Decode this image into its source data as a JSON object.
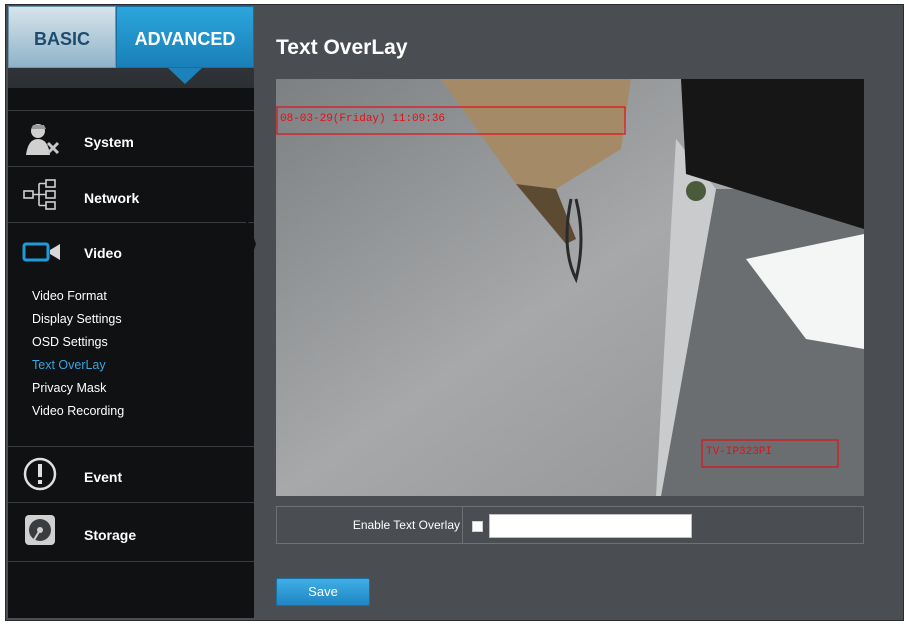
{
  "tabs": {
    "basic": "BASIC",
    "advanced": "ADVANCED"
  },
  "sidebar": {
    "sections": [
      {
        "label": "System",
        "icon": "system-admin-icon"
      },
      {
        "label": "Network",
        "icon": "network-tree-icon"
      },
      {
        "label": "Video",
        "icon": "video-camera-icon"
      },
      {
        "label": "Event",
        "icon": "exclamation-circle-icon"
      },
      {
        "label": "Storage",
        "icon": "storage-disk-icon"
      }
    ],
    "video_submenu": [
      {
        "label": "Video Format"
      },
      {
        "label": "Display Settings"
      },
      {
        "label": "OSD Settings"
      },
      {
        "label": "Text OverLay",
        "active": true
      },
      {
        "label": "Privacy Mask"
      },
      {
        "label": "Video Recording"
      }
    ]
  },
  "main": {
    "title": "Text OverLay",
    "camera": {
      "timestamp_overlay": "08-03-29(Friday) 11:09:36",
      "camera_name_overlay": "TV-IP323PI"
    },
    "enable_label": "Enable Text Overlay",
    "enable_checked": false,
    "text_value": "",
    "save_label": "Save"
  },
  "colors": {
    "accent": "#1e86c3",
    "active_link": "#3aa5de",
    "overlay_box": "#e0101a"
  }
}
